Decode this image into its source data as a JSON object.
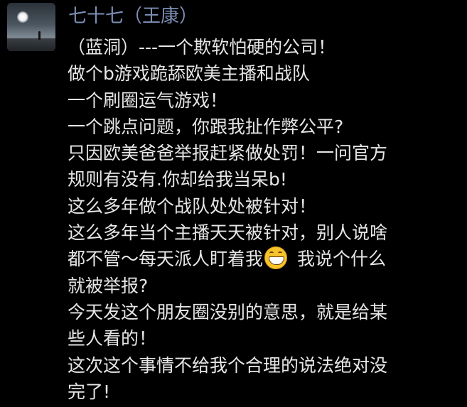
{
  "post": {
    "author": "七十七（王康）",
    "avatar_icon": "avatar-landscape-icon",
    "emoji_icon": "grinning-face-emoji-icon",
    "lines": {
      "l1": "（蓝洞）---一个欺软怕硬的公司！",
      "l2": "做个b游戏跪舔欧美主播和战队",
      "l3": "一个刷圈运气游戏！",
      "l4": "一个跳点问题，你跟我扯作弊公平?",
      "l5": "只因欧美爸爸举报赶紧做处罚！一问官方",
      "l6": "规则有没有.你却给我当呆b!",
      "l7": "这么多年做个战队处处被针对！",
      "l8": "这么多年当个主播天天被针对，别人说啥",
      "l9_before_emoji": "都不管～每天派人盯着我",
      "l9_after_emoji": "我说个什么",
      "l10": "就被举报?",
      "l11": "今天发这个朋友圈没别的意思，就是给某",
      "l12": "些人看的！",
      "l13": "这次这个事情不给我个合理的说法绝对没",
      "l14": "完了!"
    }
  }
}
